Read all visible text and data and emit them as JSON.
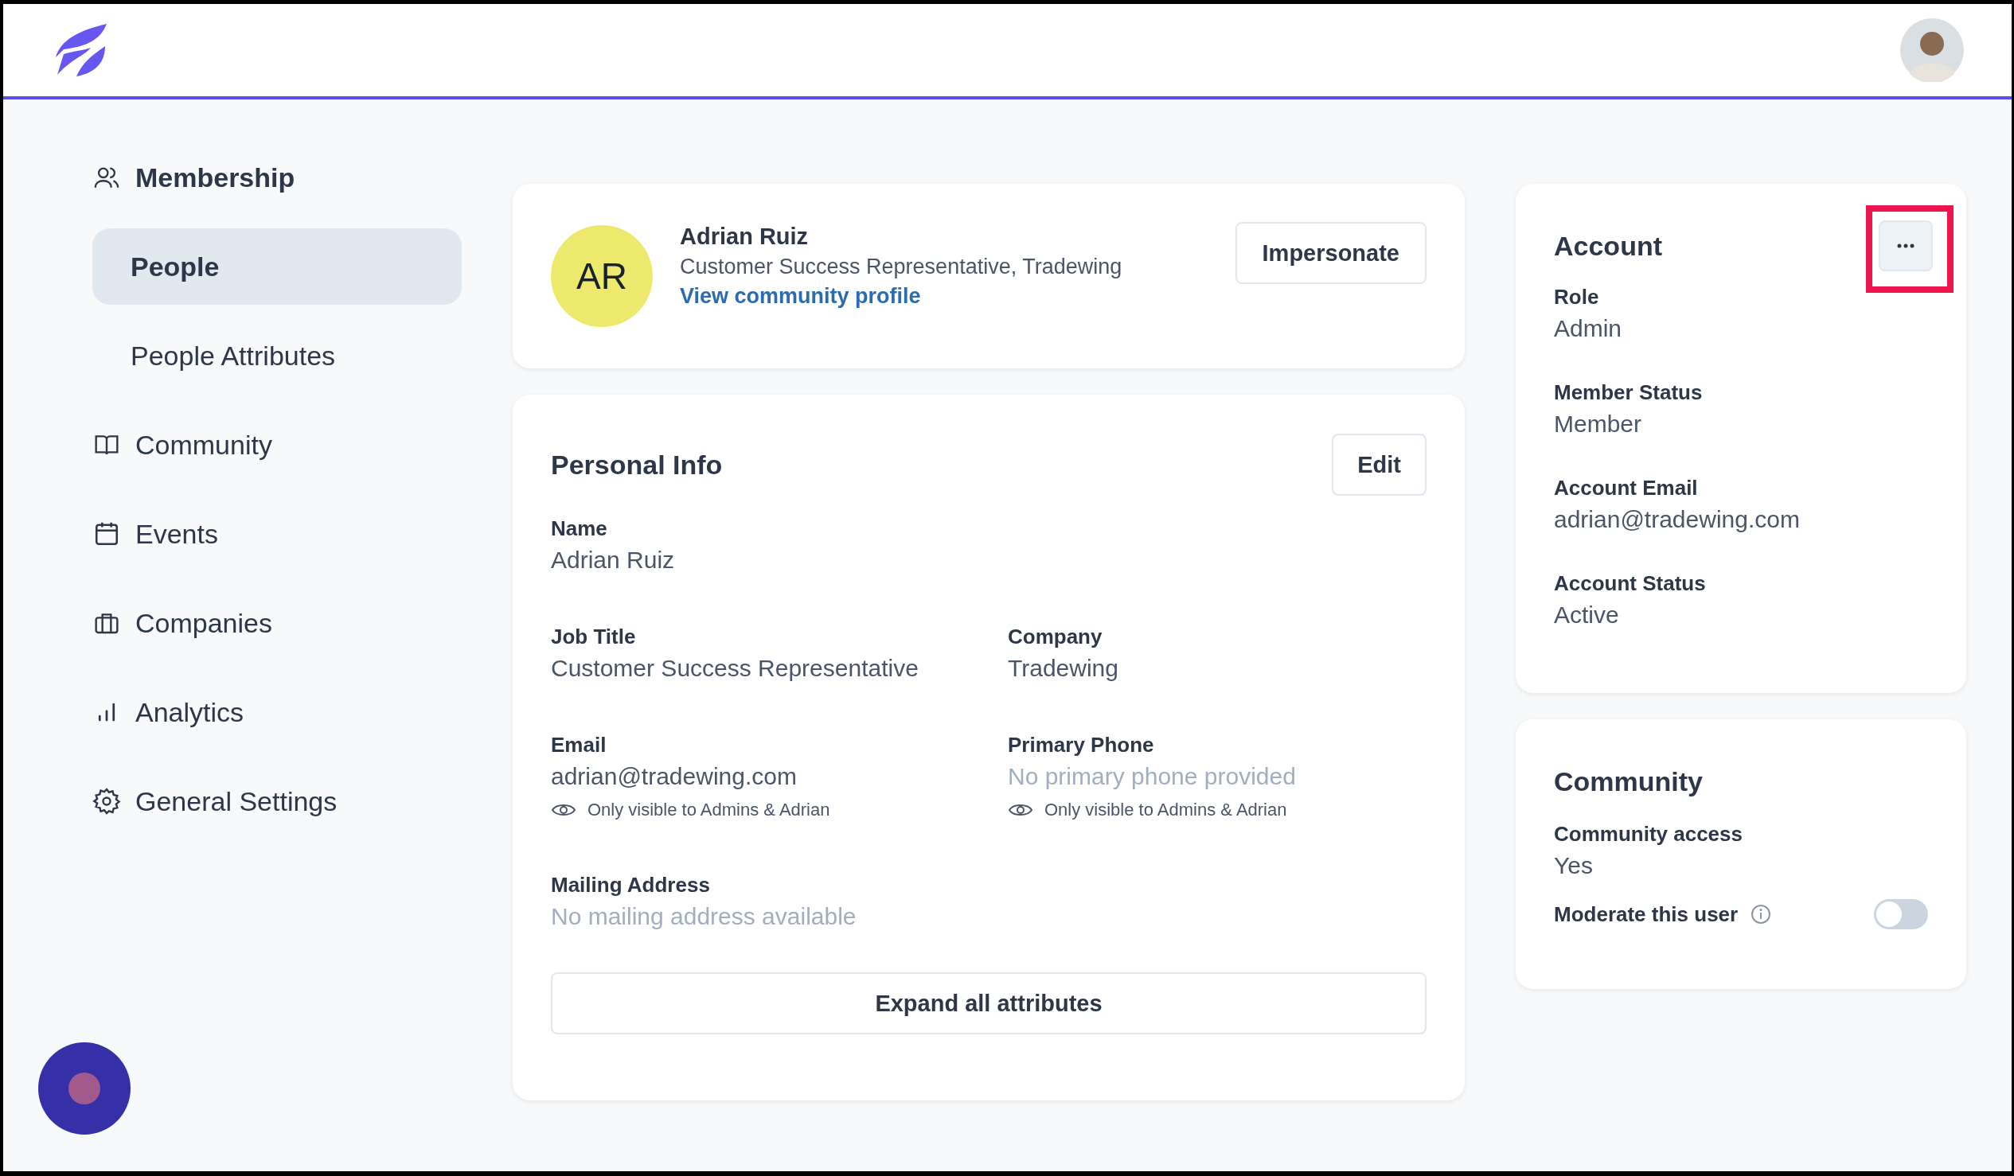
{
  "sidebar": {
    "items": [
      {
        "label": "Membership",
        "expanded": true,
        "children": [
          {
            "label": "People",
            "selected": true
          },
          {
            "label": "People Attributes",
            "selected": false
          }
        ]
      },
      {
        "label": "Community",
        "expanded": false
      },
      {
        "label": "Events",
        "expanded": false
      },
      {
        "label": "Companies",
        "expanded": false
      },
      {
        "label": "Analytics",
        "expanded": false
      },
      {
        "label": "General Settings",
        "expanded": false
      }
    ]
  },
  "profile": {
    "initials": "AR",
    "name": "Adrian Ruiz",
    "subtitle": "Customer Success Representative, Tradewing",
    "link": "View community profile",
    "button": "Impersonate"
  },
  "personal_info": {
    "title": "Personal Info",
    "button": "Edit",
    "rows": [
      [
        {
          "label": "Name",
          "value": "Adrian Ruiz",
          "empty": false
        }
      ],
      [
        {
          "label": "Job Title",
          "value": "Customer Success Representative",
          "empty": false
        },
        {
          "label": "Company",
          "value": "Tradewing",
          "empty": false
        }
      ],
      [
        {
          "label": "Email",
          "value": "adrian@tradewing.com",
          "empty": false,
          "note": "Only visible to Admins & Adrian"
        },
        {
          "label": "Primary Phone",
          "value": "No primary phone provided",
          "empty": true,
          "note": "Only visible to Admins & Adrian"
        }
      ],
      [
        {
          "label": "Mailing Address",
          "value": "No mailing address available",
          "empty": true
        }
      ]
    ],
    "expand_button": "Expand all attributes"
  },
  "account": {
    "title": "Account",
    "menu_highlighted": true,
    "fields": [
      {
        "label": "Role",
        "value": "Admin"
      },
      {
        "label": "Member Status",
        "value": "Member"
      },
      {
        "label": "Account Email",
        "value": "adrian@tradewing.com"
      },
      {
        "label": "Account Status",
        "value": "Active"
      }
    ]
  },
  "community": {
    "title": "Community",
    "fields": [
      {
        "label": "Community access",
        "value": "Yes"
      }
    ],
    "toggle": {
      "label": "Moderate this user",
      "on": false
    }
  }
}
